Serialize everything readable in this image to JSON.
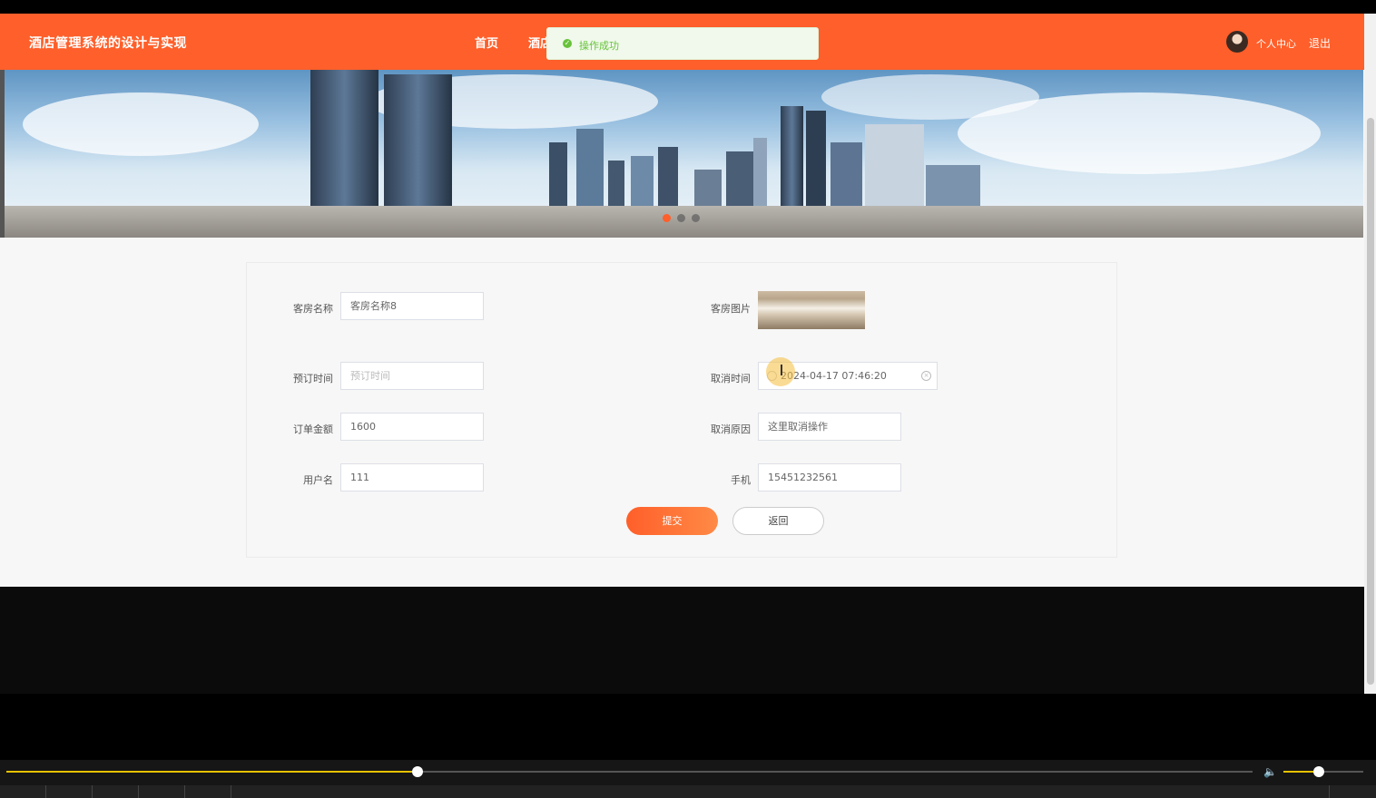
{
  "navbar": {
    "title": "酒店管理系统的设计与实现",
    "nav": [
      {
        "label": "首页"
      },
      {
        "label": "酒店"
      }
    ],
    "profile_label": "个人中心",
    "logout_label": "退出"
  },
  "toast": {
    "message": "操作成功",
    "icon": "check-circle-icon",
    "color": "#67c23a"
  },
  "banner": {
    "slide_count": 3,
    "active_slide": 1
  },
  "form": {
    "room_name": {
      "label": "客房名称",
      "value": "客房名称8"
    },
    "room_image": {
      "label": "客房图片"
    },
    "booking_time": {
      "label": "预订时间",
      "placeholder": "预订时间"
    },
    "cancel_time": {
      "label": "取消时间",
      "value": "2024-04-17 07:46:20"
    },
    "order_amount": {
      "label": "订单金额",
      "value": "1600"
    },
    "cancel_reason": {
      "label": "取消原因",
      "value": "这里取消操作"
    },
    "username": {
      "label": "用户名",
      "value": "111"
    },
    "phone": {
      "label": "手机",
      "value": "15451232561"
    },
    "submit_label": "提交",
    "back_label": "返回"
  },
  "player": {
    "progress": 0.33,
    "volume": 0.44
  },
  "colors": {
    "brand": "#ff5f2a",
    "success": "#67c23a",
    "progress": "#e6c200"
  }
}
